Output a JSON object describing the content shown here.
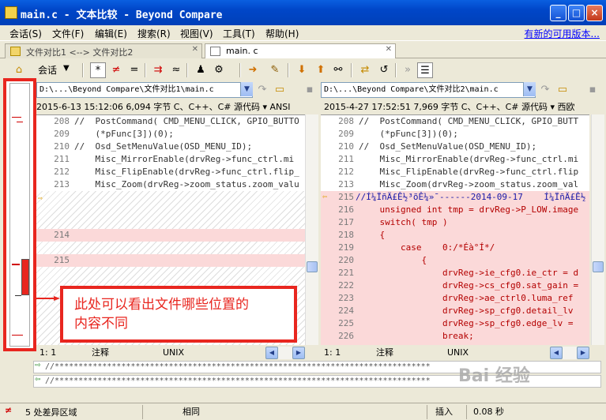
{
  "window": {
    "title": "main.c - 文本比较 - Beyond Compare",
    "minimize": "_",
    "maximize": "□",
    "close": "×"
  },
  "menu": {
    "items": [
      "会话(S)",
      "文件(F)",
      "编辑(E)",
      "搜索(R)",
      "视图(V)",
      "工具(T)",
      "帮助(H)"
    ],
    "update_link": "有新的可用版本..."
  },
  "tabs": [
    {
      "label": "文件对比1 <--> 文件对比2",
      "active": false
    },
    {
      "label": "main. c",
      "active": true
    }
  ],
  "toolbar": {
    "session_label": "会话"
  },
  "left": {
    "path": "D:\\...\\Beyond Compare\\文件对比1\\main.c",
    "info": "2015-6-13 15:12:06  6,094 字节   C、C++、C# 源代码  ▾  ANSI",
    "lines": [
      {
        "n": "208",
        "t": "//  PostCommand( CMD_MENU_CLICK, GPIO_BUTTO"
      },
      {
        "n": "209",
        "t": "    (*pFunc[3])(0);"
      },
      {
        "n": "210",
        "t": "//  Osd_SetMenuValue(OSD_MENU_ID);"
      },
      {
        "n": "211",
        "t": "    Misc_MirrorEnable(drvReg->func_ctrl.mi"
      },
      {
        "n": "212",
        "t": "    Misc_FlipEnable(drvReg->func_ctrl.flip_"
      },
      {
        "n": "213",
        "t": "    Misc_Zoom(drvReg->zoom_status.zoom_valu"
      }
    ],
    "marker1": "214",
    "marker2": "215",
    "status": {
      "pos": "1: 1",
      "type": "注释",
      "eol": "UNIX"
    }
  },
  "right": {
    "path": "D:\\...\\Beyond Compare\\文件对比2\\main.c",
    "info": "2015-4-27 17:52:51  7,969 字节   C、C++、C# 源代码  ▾  西欧",
    "lines": [
      {
        "n": "208",
        "t": "//  PostCommand( CMD_MENU_CLICK, GPIO_BUTT"
      },
      {
        "n": "209",
        "t": "    (*pFunc[3])(0);"
      },
      {
        "n": "210",
        "t": "//  Osd_SetMenuValue(OSD_MENU_ID);"
      },
      {
        "n": "211",
        "t": "    Misc_MirrorEnable(drvReg->func_ctrl.mi"
      },
      {
        "n": "212",
        "t": "    Misc_FlipEnable(drvReg->func_ctrl.flip"
      },
      {
        "n": "213",
        "t": "    Misc_Zoom(drvReg->zoom_status.zoom_val"
      }
    ],
    "diff_lines": [
      {
        "n": "215",
        "t": "//Í¼ÏñÄ£Ê½³õÊ¼»¯------2014-09-17    Í¼ÏñÄ£Ê½"
      },
      {
        "n": "216",
        "t": "    unsigned int tmp = drvReg->P_LOW.image"
      },
      {
        "n": "217",
        "t": "    switch( tmp )"
      },
      {
        "n": "218",
        "t": "    {"
      },
      {
        "n": "219",
        "t": "        case    0:/*Éà°Í*/"
      },
      {
        "n": "220",
        "t": "            {"
      },
      {
        "n": "221",
        "t": "                drvReg->ie_cfg0.ie_ctr = d"
      },
      {
        "n": "222",
        "t": "                drvReg->cs_cfg0.sat_gain ="
      },
      {
        "n": "223",
        "t": "                drvReg->ae_ctrl0.luma_ref"
      },
      {
        "n": "224",
        "t": "                drvReg->sp_cfg0.detail_lv"
      },
      {
        "n": "225",
        "t": "                drvReg->sp_cfg0.edge_lv ="
      },
      {
        "n": "226",
        "t": "                break;"
      }
    ],
    "status": {
      "pos": "1: 1",
      "type": "注释",
      "eol": "UNIX"
    }
  },
  "merge": {
    "line1": "//*******************************************************************************",
    "line2": "//*******************************************************************************"
  },
  "statusbar": {
    "diff_count": "5 处差异区域",
    "same": "相同",
    "mode": "插入",
    "time": "0.08 秒"
  },
  "annotation": {
    "line1": "此处可以看出文件哪些位置的",
    "line2": "内容不同"
  },
  "watermark": "Bai 经验",
  "colors": {
    "annotation_red": "#e8261f",
    "diff_pink": "#fbd9d9",
    "diff_text": "#b40000",
    "title_blue": "#0046c8"
  }
}
